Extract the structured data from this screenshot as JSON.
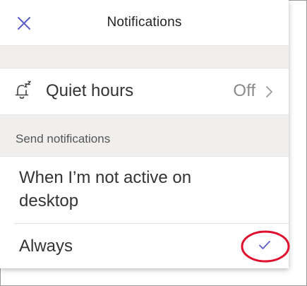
{
  "header": {
    "title": "Notifications",
    "close_icon": "close-icon"
  },
  "quiet_hours": {
    "icon": "bell-zz-icon",
    "label": "Quiet hours",
    "value": "Off",
    "chevron_icon": "chevron-right-icon"
  },
  "section": {
    "label": "Send notifications"
  },
  "options": [
    {
      "label": "When I’m not active on desktop",
      "selected": false
    },
    {
      "label": "Always",
      "selected": true
    }
  ],
  "colors": {
    "accent": "#5b5fc7",
    "highlight_ring": "#e0102f",
    "section_bg": "#f0efee"
  }
}
